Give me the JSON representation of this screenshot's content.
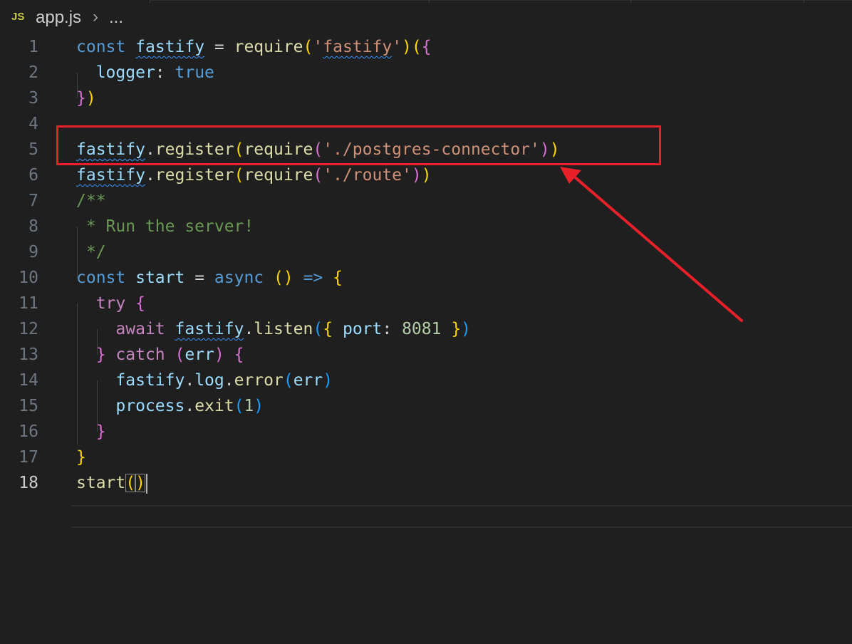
{
  "breadcrumb": {
    "file_icon": "JS",
    "file_name": "app.js",
    "separator_icon": "chevron-right-icon",
    "rest": "..."
  },
  "editor": {
    "active_line": 18,
    "lines": [
      {
        "number": "1",
        "tokens": [
          [
            "const",
            "k"
          ],
          [
            " ",
            "p"
          ],
          [
            "fastify",
            "v squig"
          ],
          [
            " = ",
            "p"
          ],
          [
            "require",
            "f"
          ],
          [
            "(",
            "b1"
          ],
          [
            "'",
            "s"
          ],
          [
            "fastify",
            "s squig"
          ],
          [
            "'",
            "s"
          ],
          [
            ")",
            "b1"
          ],
          [
            "(",
            "b1"
          ],
          [
            "{",
            "b2"
          ]
        ]
      },
      {
        "number": "2",
        "tokens": [
          [
            "  ",
            "p"
          ],
          [
            "logger",
            "v"
          ],
          [
            ": ",
            "p"
          ],
          [
            "true",
            "k"
          ]
        ]
      },
      {
        "number": "3",
        "tokens": [
          [
            "}",
            "b2"
          ],
          [
            ")",
            "b1"
          ]
        ]
      },
      {
        "number": "4",
        "tokens": []
      },
      {
        "number": "5",
        "tokens": [
          [
            "fastify",
            "v squig"
          ],
          [
            ".",
            "p"
          ],
          [
            "register",
            "f"
          ],
          [
            "(",
            "b1"
          ],
          [
            "require",
            "f"
          ],
          [
            "(",
            "b2"
          ],
          [
            "'./postgres-connector'",
            "s"
          ],
          [
            ")",
            "b2"
          ],
          [
            ")",
            "b1"
          ]
        ]
      },
      {
        "number": "6",
        "tokens": [
          [
            "fastify",
            "v squig"
          ],
          [
            ".",
            "p"
          ],
          [
            "register",
            "f"
          ],
          [
            "(",
            "b1"
          ],
          [
            "require",
            "f"
          ],
          [
            "(",
            "b2"
          ],
          [
            "'./route'",
            "s"
          ],
          [
            ")",
            "b2"
          ],
          [
            ")",
            "b1"
          ]
        ]
      },
      {
        "number": "7",
        "tokens": [
          [
            "/**",
            "c"
          ]
        ]
      },
      {
        "number": "8",
        "tokens": [
          [
            " * Run the server!",
            "c"
          ]
        ]
      },
      {
        "number": "9",
        "tokens": [
          [
            " */",
            "c"
          ]
        ]
      },
      {
        "number": "10",
        "tokens": [
          [
            "const",
            "k"
          ],
          [
            " ",
            "p"
          ],
          [
            "start",
            "v"
          ],
          [
            " = ",
            "p"
          ],
          [
            "async",
            "k"
          ],
          [
            " ",
            "p"
          ],
          [
            "()",
            "b1"
          ],
          [
            " ",
            "p"
          ],
          [
            "=>",
            "k"
          ],
          [
            " ",
            "p"
          ],
          [
            "{",
            "b1"
          ]
        ]
      },
      {
        "number": "11",
        "tokens": [
          [
            "  ",
            "p"
          ],
          [
            "try",
            "kc"
          ],
          [
            " ",
            "p"
          ],
          [
            "{",
            "b2"
          ]
        ]
      },
      {
        "number": "12",
        "tokens": [
          [
            "    ",
            "p"
          ],
          [
            "await",
            "kc"
          ],
          [
            " ",
            "p"
          ],
          [
            "fastify",
            "v squig"
          ],
          [
            ".",
            "p"
          ],
          [
            "listen",
            "f"
          ],
          [
            "(",
            "b3"
          ],
          [
            "{",
            "b1"
          ],
          [
            " ",
            "p"
          ],
          [
            "port",
            "v"
          ],
          [
            ": ",
            "p"
          ],
          [
            "8081",
            "n"
          ],
          [
            " ",
            "p"
          ],
          [
            "}",
            "b1"
          ],
          [
            ")",
            "b3"
          ]
        ]
      },
      {
        "number": "13",
        "tokens": [
          [
            "  ",
            "p"
          ],
          [
            "}",
            "b2"
          ],
          [
            " ",
            "p"
          ],
          [
            "catch",
            "kc"
          ],
          [
            " ",
            "p"
          ],
          [
            "(",
            "b2"
          ],
          [
            "err",
            "v"
          ],
          [
            ")",
            "b2"
          ],
          [
            " ",
            "p"
          ],
          [
            "{",
            "b2"
          ]
        ]
      },
      {
        "number": "14",
        "tokens": [
          [
            "    ",
            "p"
          ],
          [
            "fastify",
            "v"
          ],
          [
            ".",
            "p"
          ],
          [
            "log",
            "v"
          ],
          [
            ".",
            "p"
          ],
          [
            "error",
            "f"
          ],
          [
            "(",
            "b3"
          ],
          [
            "err",
            "v"
          ],
          [
            ")",
            "b3"
          ]
        ]
      },
      {
        "number": "15",
        "tokens": [
          [
            "    ",
            "p"
          ],
          [
            "process",
            "v"
          ],
          [
            ".",
            "p"
          ],
          [
            "exit",
            "f"
          ],
          [
            "(",
            "b3"
          ],
          [
            "1",
            "n"
          ],
          [
            ")",
            "b3"
          ]
        ]
      },
      {
        "number": "16",
        "tokens": [
          [
            "  ",
            "p"
          ],
          [
            "}",
            "b2"
          ]
        ]
      },
      {
        "number": "17",
        "tokens": [
          [
            "}",
            "b1"
          ]
        ]
      },
      {
        "number": "18",
        "tokens": [
          [
            "start",
            "f"
          ],
          [
            "(",
            "b1 bracket-match"
          ],
          [
            ")",
            "b1 bracket-match"
          ]
        ]
      }
    ]
  },
  "annotation": {
    "box_color": "#e8202a",
    "arrow_color": "#e8202a",
    "arrow_icon": "arrow-icon"
  }
}
